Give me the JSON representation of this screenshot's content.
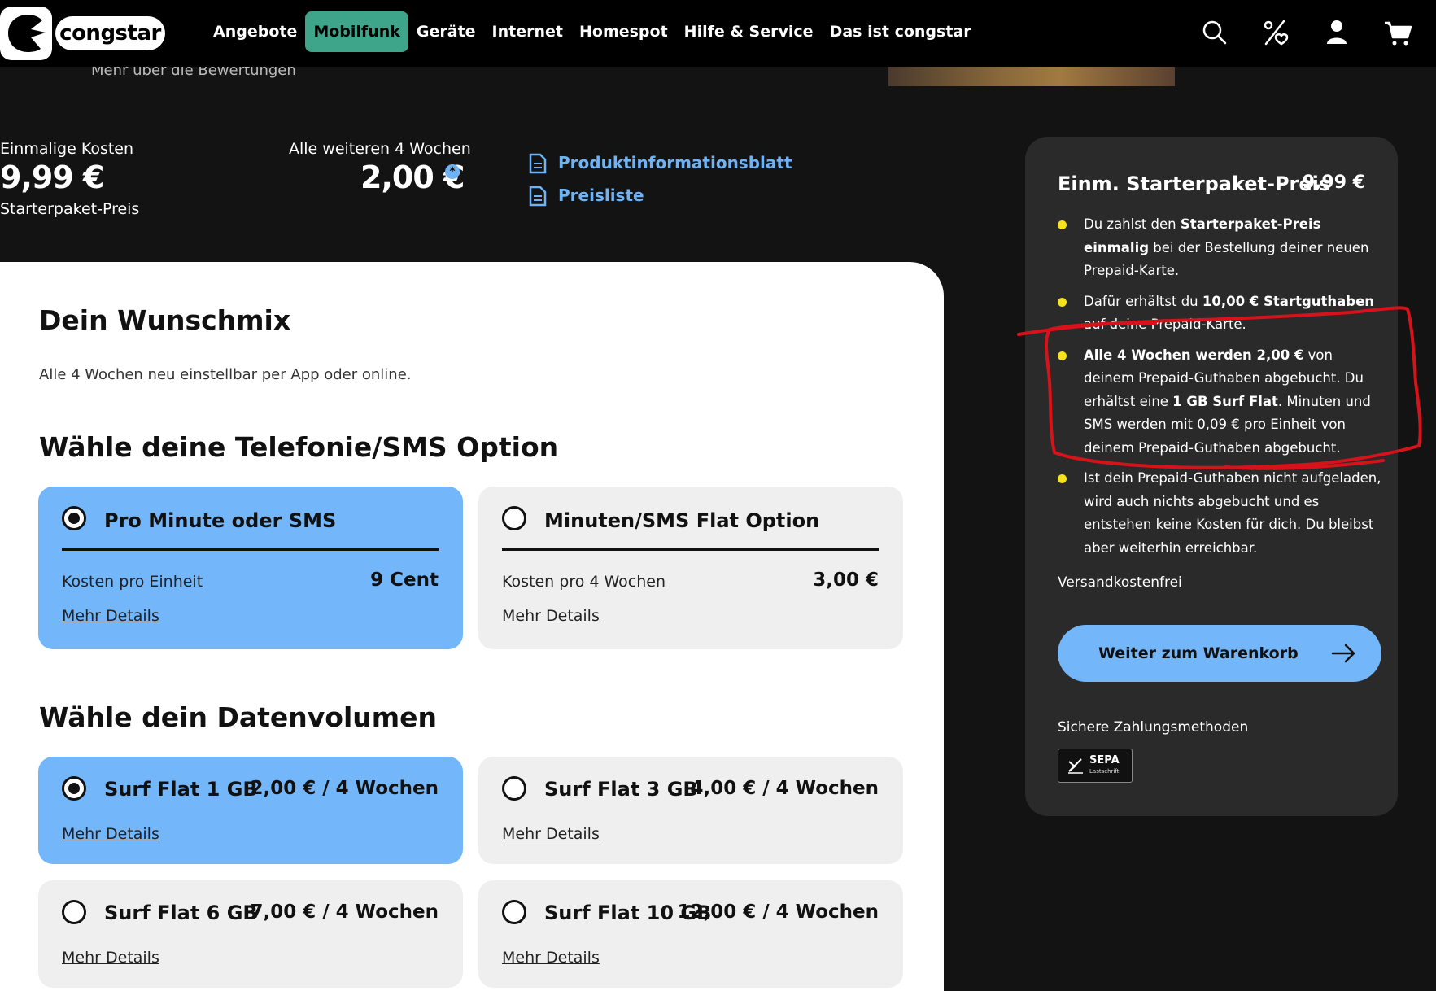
{
  "header": {
    "logo_text": "congstar",
    "nav": [
      "Angebote",
      "Mobilfunk",
      "Geräte",
      "Internet",
      "Homespot",
      "Hilfe & Service",
      "Das ist congstar"
    ],
    "active_nav": "Mobilfunk",
    "icons": [
      "search-icon",
      "percent-heart-icon",
      "user-icon",
      "cart-icon"
    ]
  },
  "strip": {
    "reviews_link": "Mehr über die Bewertungen"
  },
  "costs": {
    "once_label": "Einmalige Kosten",
    "once_value": "9,99 €",
    "once_sub": "Starterpaket-Preis",
    "recurring_label": "Alle weiteren 4 Wochen",
    "recurring_value": "2,00 €",
    "info_mark": "*",
    "links": [
      "Produktinformationsblatt",
      "Preisliste"
    ]
  },
  "main": {
    "title": "Dein Wunschmix",
    "subtitle": "Alle 4 Wochen neu einstellbar per App oder online.",
    "telephony_heading": "Wähle deine Telefonie/SMS Option",
    "telephony_options": [
      {
        "title": "Pro Minute oder SMS",
        "label": "Kosten pro Einheit",
        "price": "9 Cent",
        "more": "Mehr Details",
        "selected": true
      },
      {
        "title": "Minuten/SMS Flat Option",
        "label": "Kosten pro 4 Wochen",
        "price": "3,00 €",
        "more": "Mehr Details",
        "selected": false
      }
    ],
    "data_heading": "Wähle dein Datenvolumen",
    "data_options": [
      {
        "title": "Surf Flat 1 GB",
        "price": "2,00 € / 4 Wochen",
        "more": "Mehr Details",
        "selected": true
      },
      {
        "title": "Surf Flat 3 GB",
        "price": "4,00 € / 4 Wochen",
        "more": "Mehr Details",
        "selected": false
      },
      {
        "title": "Surf Flat 6 GB",
        "price": "7,00 € / 4 Wochen",
        "more": "Mehr Details",
        "selected": false
      },
      {
        "title": "Surf Flat 10 GB",
        "price": "12,00 € / 4 Wochen",
        "more": "Mehr Details",
        "selected": false
      }
    ]
  },
  "sidebar": {
    "title": "Einm. Starterpaket-Preis",
    "price": "9,99 €",
    "bullets": [
      [
        "Du zahlst den ",
        "Starterpaket-Preis einmalig",
        " bei der Bestellung deiner neuen Prepaid-Karte."
      ],
      [
        "Dafür erhältst du ",
        "10,00 € Startguthaben",
        " auf deine Prepaid-Karte."
      ],
      [
        "",
        "Alle 4 Wochen werden 2,00 €",
        " von deinem Prepaid-Guthaben abgebucht. Du erhältst eine ",
        "1 GB Surf Flat",
        ". Minuten und SMS werden mit 0,09 € pro Einheit von deinem Prepaid-Guthaben abgebucht."
      ],
      [
        "Ist dein Prepaid-Guthaben nicht aufgeladen, wird auch nichts abgebucht und es entstehen keine Kosten für dich. Du bleibst aber weiterhin erreichbar."
      ]
    ],
    "shipping": "Versandkostenfrei",
    "cta": "Weiter zum Warenkorb",
    "payment_label": "Sichere Zahlungsmethoden",
    "sepa_title": "SEPA",
    "sepa_sub": "Lastschrift"
  },
  "colors": {
    "accent_blue": "#73b6f9",
    "link_blue": "#6fb3f5",
    "nav_active": "#3fa58a",
    "bullet_yellow": "#f5e21c",
    "annotation_red": "#d6121b"
  }
}
